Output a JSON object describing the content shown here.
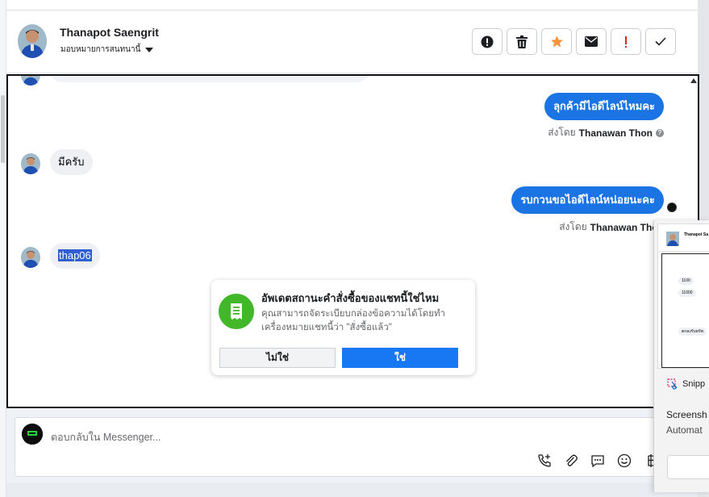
{
  "header": {
    "contact_name": "Thanapot Saengrit",
    "assign_label": "มอบหมายการสนทนานี้",
    "actions": [
      {
        "icon": "alert-circle-icon"
      },
      {
        "icon": "trash-icon"
      },
      {
        "icon": "star-icon",
        "color": "#f7923b"
      },
      {
        "icon": "mail-icon"
      },
      {
        "icon": "exclamation-icon",
        "color": "#e02424"
      },
      {
        "icon": "check-icon"
      }
    ]
  },
  "messages": [
    {
      "direction": "out",
      "text": "ลุกค้ามีไอดีไลน์ไหมคะ",
      "sent_by_prefix": "ส่งโดย",
      "sent_by_name": "Thanawan Thon"
    },
    {
      "direction": "in",
      "text": "มีครับ"
    },
    {
      "direction": "out",
      "text": "รบกวนขอไอดีไลน์หน่อยนะคะ",
      "sent_by_prefix": "ส่งโดย",
      "sent_by_name": "Thanawan Thon"
    },
    {
      "direction": "in",
      "text": "thap06"
    }
  ],
  "order_prompt": {
    "title": "อัพเดตสถานะคำสั่งซื้อของแชทนี้ใช่ไหม",
    "description": "คุณสามารถจัดระเบียบกล่องข้อความได้โดยทำเครื่องหมายแชทนี้ว่า \"สั่งซื้อแล้ว\"",
    "no_label": "ไม่ใช่",
    "yes_label": "ใช่",
    "icon": "receipt-icon",
    "accent": "#42b72a"
  },
  "composer": {
    "placeholder": "ตอบกลับใน Messenger...",
    "tools": [
      "add-call-icon",
      "paperclip-icon",
      "saved-reply-icon",
      "emoji-icon",
      "currency-baht-icon"
    ]
  },
  "snipping_popup": {
    "thumb_name": "Thanapot Sa",
    "thumb_pills": [
      "1100",
      "11000",
      "ตกลงรับทรัพ"
    ],
    "app_name": "Snipp",
    "line1": "Screensh",
    "line2": "Automat"
  },
  "colors": {
    "brand_blue": "#1b74e4",
    "button_blue": "#1877f2",
    "selection": "#2f5fd2"
  }
}
